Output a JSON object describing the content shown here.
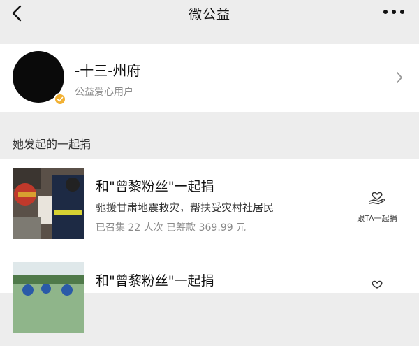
{
  "navbar": {
    "title": "微公益",
    "back_icon": "chevron-left-icon",
    "more_icon": "more-dots-icon"
  },
  "profile": {
    "name": "-十三-州府",
    "role": "公益爱心用户",
    "badge_color": "#f2b134"
  },
  "section": {
    "title": "她发起的一起捐"
  },
  "donations": [
    {
      "title": "和\"曾黎粉丝\"一起捐",
      "description": "驰援甘肃地震救灾，帮扶受灾村社居民",
      "stats": "已召集 22 人次  已筹款 369.99 元",
      "action_label": "跟TA一起捐",
      "action_icon": "heart-hand-icon"
    },
    {
      "title": "和\"曾黎粉丝\"一起捐"
    }
  ],
  "colors": {
    "background": "#ededed",
    "card": "#ffffff",
    "secondary_text": "#8a8a8a"
  }
}
